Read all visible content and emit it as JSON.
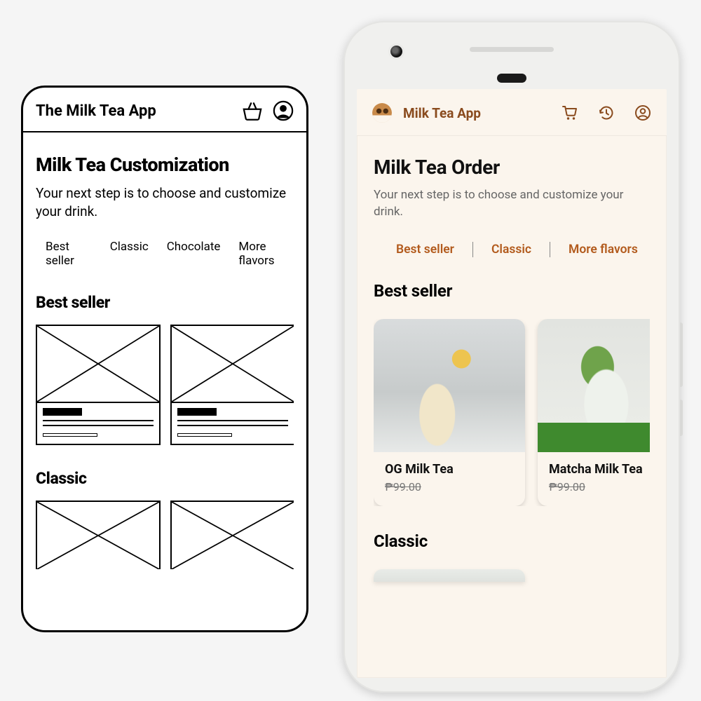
{
  "wireframe": {
    "app_title": "The Milk Tea App",
    "page_title": "Milk Tea Customization",
    "subtitle": "Your next step is to choose and customize your drink.",
    "tabs": [
      "Best seller",
      "Classic",
      "Chocolate",
      "More flavors"
    ],
    "sections": [
      "Best seller",
      "Classic"
    ]
  },
  "hifi": {
    "brand": "Milk Tea App",
    "page_title": "Milk Tea Order",
    "subtitle": "Your next step is to choose and customize your drink.",
    "tabs": [
      "Best seller",
      "Classic",
      "More flavors"
    ],
    "sections": {
      "best_seller": {
        "title": "Best seller",
        "items": [
          {
            "name": "OG Milk Tea",
            "price": "₱99.00"
          },
          {
            "name": "Matcha Milk Tea",
            "price": "₱99.00"
          }
        ]
      },
      "classic": {
        "title": "Classic"
      }
    },
    "colors": {
      "accent": "#b25a1c",
      "bg": "#fbf5ed"
    }
  }
}
